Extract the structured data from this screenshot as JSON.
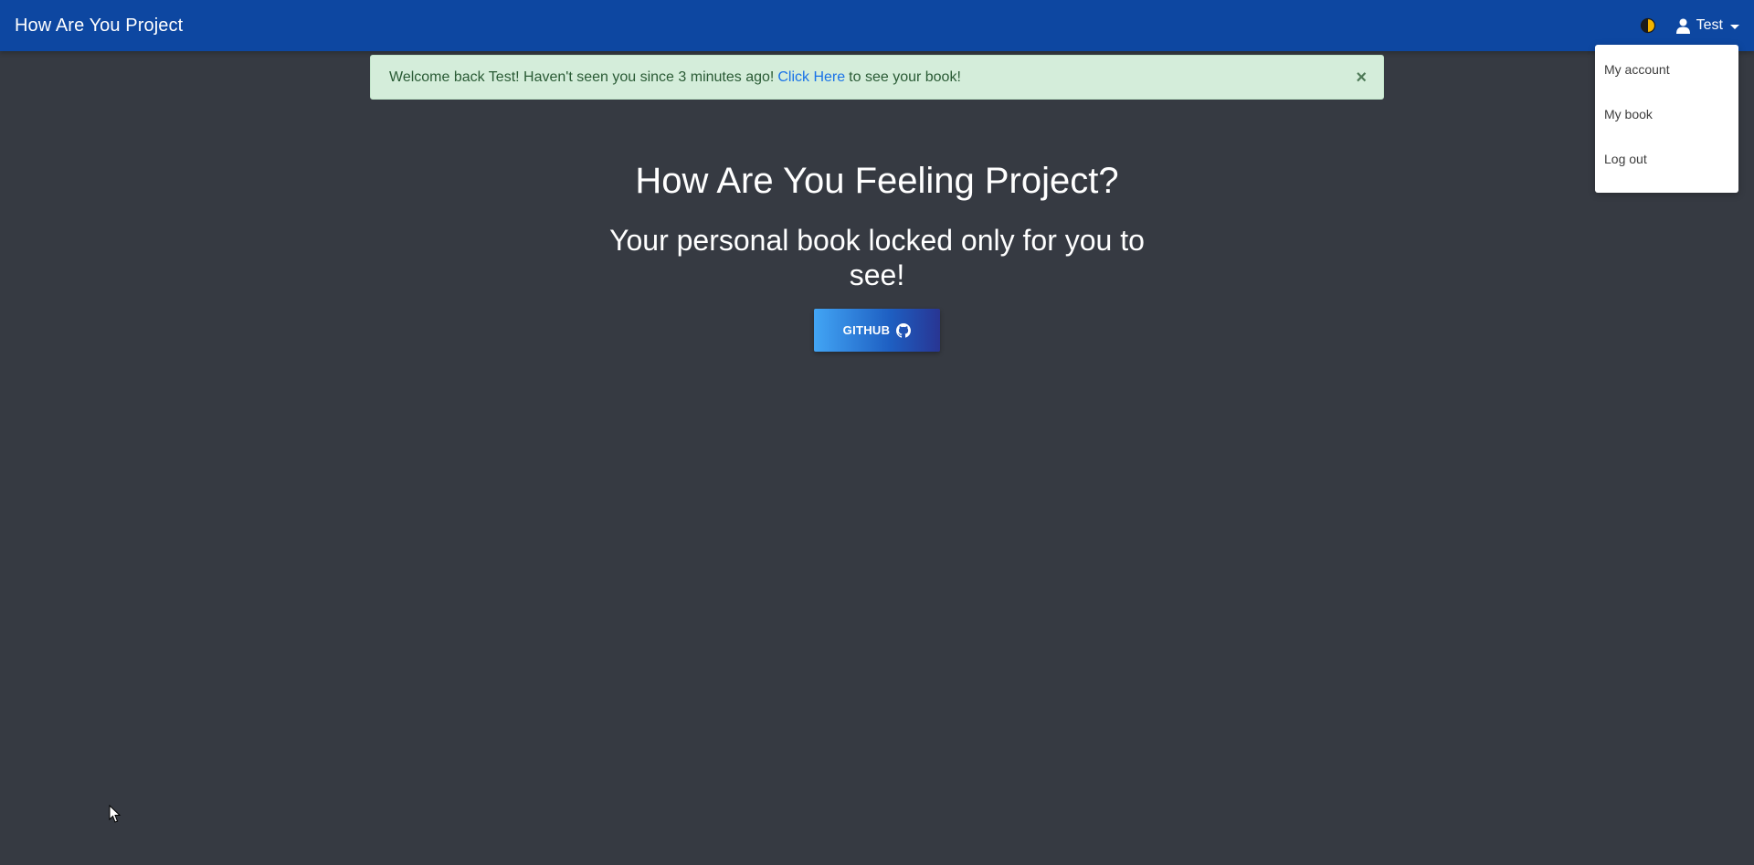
{
  "navbar": {
    "brand": "How Are You Project",
    "theme_toggle_icon": "half-moon-icon",
    "user": {
      "icon": "user-icon",
      "name": "Test"
    }
  },
  "dropdown": {
    "items": [
      {
        "label": "My account"
      },
      {
        "label": "My book"
      },
      {
        "label": "Log out"
      }
    ]
  },
  "alert": {
    "text_before": "Welcome back Test! Haven't seen you since 3 minutes ago!",
    "link_text": "Click Here",
    "text_after": "to see your book!",
    "close_glyph": "×"
  },
  "hero": {
    "title": "How Are You Feeling Project?",
    "subtitle": "Your personal book locked only for you to see!",
    "github_label": "GITHUB",
    "github_icon": "github-icon"
  },
  "colors": {
    "navbar": "#0d47a1",
    "background": "#363a42",
    "alert_bg": "#d4edda",
    "link": "#1a73e8"
  }
}
